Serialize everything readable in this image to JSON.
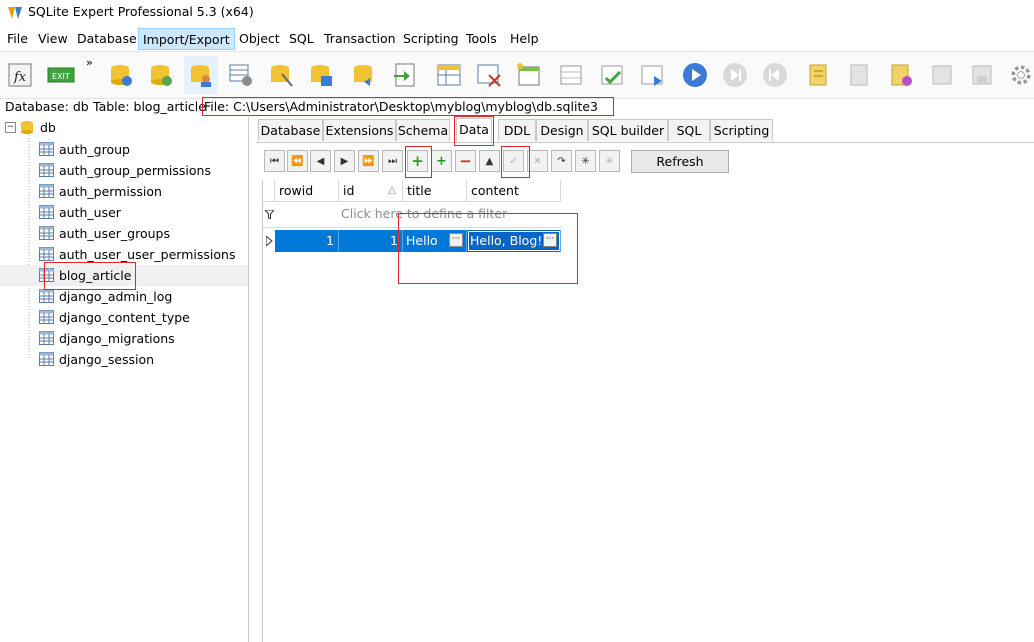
{
  "window": {
    "title": "SQLite Expert Professional 5.3 (x64)"
  },
  "menu": [
    "File",
    "View",
    "Database",
    "Import/Export",
    "Object",
    "SQL",
    "Transaction",
    "Scripting",
    "Tools",
    "Help"
  ],
  "menu_active": "Import/Export",
  "toolbar": {
    "fx_label": "fx",
    "exit_label": "EXIT",
    "more_label": "»"
  },
  "pathbar": {
    "database": "Database: db",
    "table": "Table: blog_article",
    "file": "File: C:\\Users\\Administrator\\Desktop\\myblog\\myblog\\db.sqlite3"
  },
  "tree": {
    "root": "db",
    "tables": [
      "auth_group",
      "auth_group_permissions",
      "auth_permission",
      "auth_user",
      "auth_user_groups",
      "auth_user_user_permissions",
      "blog_article",
      "django_admin_log",
      "django_content_type",
      "django_migrations",
      "django_session"
    ],
    "selected": "blog_article"
  },
  "tabs": [
    "Database",
    "Extensions",
    "Schema",
    "Data",
    "DDL",
    "Design",
    "SQL builder",
    "SQL",
    "Scripting"
  ],
  "active_tab": "Data",
  "navigator": {
    "buttons": [
      "⏮",
      "⏪",
      "◀",
      "▶",
      "⏩",
      "⏭",
      "+",
      "+",
      "−",
      "▲",
      "✓",
      "✕",
      "↷",
      "✳",
      "✳"
    ],
    "refresh_label": "Refresh"
  },
  "grid": {
    "columns": [
      "rowid",
      "id",
      "title",
      "content"
    ],
    "filter_placeholder": "Click here to define a filter",
    "rows": [
      {
        "rowid": "1",
        "id": "1",
        "title": "Hello",
        "content": "Hello, Blog!"
      }
    ],
    "sort_indicator": "△",
    "ellipsis": "···"
  },
  "colors": {
    "highlight": "#e0262a",
    "selection": "#0078d7",
    "menu_active": "#cce8ff"
  }
}
